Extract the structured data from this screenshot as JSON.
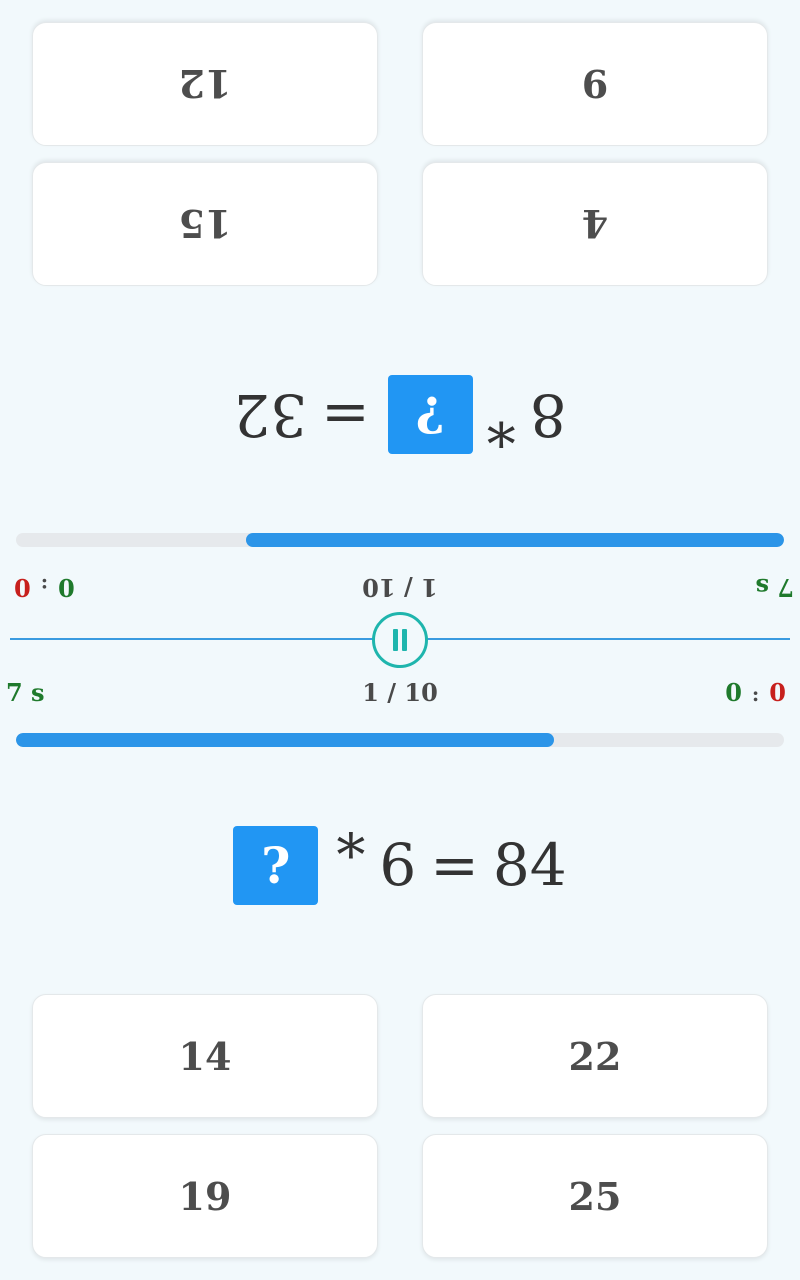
{
  "top_player": {
    "timer": "7 s",
    "round": "1 / 10",
    "score": {
      "mine": "0",
      "separator": ":",
      "theirs": "0"
    },
    "progress": 0.7,
    "equation": {
      "placeholder": "?",
      "operator": "*",
      "operand": "8",
      "equals": "=",
      "result": "32"
    },
    "answers": [
      "12",
      "9",
      "15",
      "4"
    ]
  },
  "bottom_player": {
    "timer": "7 s",
    "round": "1 / 10",
    "score": {
      "mine": "0",
      "separator": ":",
      "theirs": "0"
    },
    "progress": 0.7,
    "equation": {
      "placeholder": "?",
      "operator": "*",
      "operand": "6",
      "equals": "=",
      "result": "84"
    },
    "answers": [
      "14",
      "22",
      "19",
      "25"
    ]
  },
  "colors": {
    "accent": "#2196f3",
    "timer": "#1f7a2c",
    "opponent_score": "#c7201d",
    "pause": "#1fb5ad",
    "background": "#f2f9fc"
  }
}
